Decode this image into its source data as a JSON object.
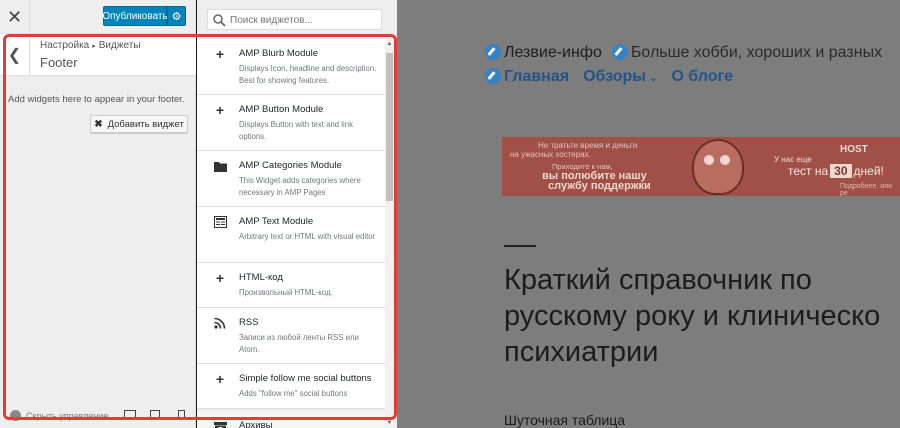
{
  "topbar": {
    "close_icon": "close-icon",
    "publish_label": "Опубликовать",
    "settings_icon": "gear-icon"
  },
  "section": {
    "breadcrumb_root": "Настройка",
    "breadcrumb_current": "Виджеты",
    "title": "Footer"
  },
  "widget_area": {
    "description": "Add widgets here to appear in your footer.",
    "add_widget_label": "Добавить виджет"
  },
  "footer": {
    "hide_controls_label": "Скрыть управление"
  },
  "search": {
    "placeholder": "Поиск виджетов..."
  },
  "widgets": [
    {
      "icon": "plus",
      "title": "AMP Blurb Module",
      "desc": "Displays Icon, headline and description. Best for showing features."
    },
    {
      "icon": "plus",
      "title": "AMP Button Module",
      "desc": "Displays Button with text and link options."
    },
    {
      "icon": "folder",
      "title": "AMP Categories Module",
      "desc": "This Widget adds categories where necessary in AMP Pages"
    },
    {
      "icon": "text-block",
      "title": "AMP Text Module",
      "desc": "Arbitrary text or HTML with visual editor"
    },
    {
      "icon": "plus",
      "title": "HTML-код",
      "desc": "Произвольный HTML-код."
    },
    {
      "icon": "rss",
      "title": "RSS",
      "desc": "Записи из любой ленты RSS или Atom."
    },
    {
      "icon": "plus",
      "title": "Simple follow me social buttons",
      "desc": "Adds \"follow me\" social buttons"
    },
    {
      "icon": "archive",
      "title": "Архивы",
      "desc": ""
    }
  ],
  "preview": {
    "site_title": "Лезвие-инфо",
    "site_description": "Больше хобби, хороших и разных",
    "nav": [
      "Главная",
      "Обзоры",
      "О блоге"
    ],
    "banner": {
      "line1": "Не тратьте время и деньги",
      "line2": "на ужасных хостерах.",
      "line3": "Приходите к нам,",
      "line4": "вы полюбите нашу",
      "line5": "службу поддержки",
      "brand": "HOST",
      "line6": "У нас еще",
      "test_prefix": "тест на",
      "test_days": "30",
      "test_suffix": "дней!",
      "line8": "Подробнее, или ре"
    },
    "post_title_lines": [
      "Краткий справочник по",
      "русскому року и клиническо",
      "психиатрии"
    ],
    "post_subtitle": "Шуточная таблица"
  },
  "colors": {
    "accent": "#0085ba",
    "highlight": "#e23c37",
    "nav_link": "#24528a"
  }
}
